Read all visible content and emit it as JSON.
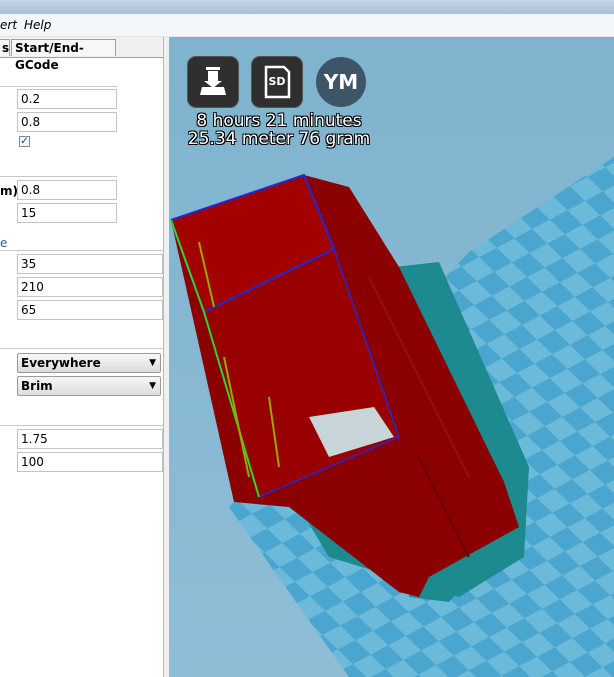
{
  "menu": {
    "insert_fragment": "ert",
    "help": "Help"
  },
  "tabs": {
    "cut": "s",
    "gcode": "Start/End-GCode"
  },
  "fields": {
    "layer_height": "0.2",
    "shell_thickness": "0.8",
    "bottom_top_thickness": "0.8",
    "fill_density": "15",
    "print_speed": "35",
    "print_temperature": "210",
    "bed_temperature": "65",
    "filament_diameter": "1.75",
    "flow": "100"
  },
  "labels": {
    "bottom_top_fragment": "m)",
    "speed_fragment": "e"
  },
  "checkbox": {
    "enable_retraction_mark": "✓"
  },
  "selects": {
    "support_type": "Everywhere",
    "platform_adhesion": "Brim"
  },
  "viewport": {
    "icons": [
      "load-model-icon",
      "save-to-sd-icon",
      "ym-plugin-icon"
    ],
    "ym_label": "YM",
    "sd_label": "SD",
    "print_time": "8 hours 21 minutes",
    "print_material": "25.34 meter 76 gram"
  },
  "colors": {
    "model_red": "#8b0000",
    "model_red_light": "#a30000",
    "bed_blue": "#5fb3d6",
    "bed_checker": "#4aa5cf",
    "shadow_teal": "#1d8a8f",
    "outline_blue": "#1f2ad6",
    "outline_green": "#2fd62f"
  }
}
